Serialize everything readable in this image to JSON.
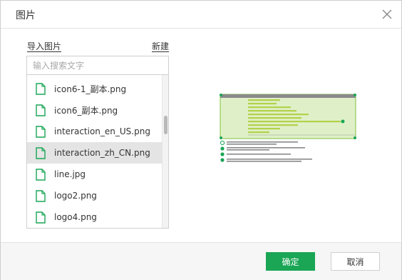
{
  "dialog": {
    "title": "图片",
    "close_icon": "close-icon"
  },
  "panel": {
    "import_label": "导入图片",
    "new_label": "新建",
    "search_placeholder": "输入搜索文字"
  },
  "files": [
    {
      "name": "icon6-1_副本.png",
      "selected": false
    },
    {
      "name": "icon6_副本.png",
      "selected": false
    },
    {
      "name": "interaction_en_US.png",
      "selected": false
    },
    {
      "name": "interaction_zh_CN.png",
      "selected": true
    },
    {
      "name": "line.jpg",
      "selected": false
    },
    {
      "name": "logo2.png",
      "selected": false
    },
    {
      "name": "logo4.png",
      "selected": false
    }
  ],
  "colors": {
    "file_icon": "#1aa655",
    "primary": "#1aa655",
    "selected_row": "#e4e4e4"
  },
  "footer": {
    "ok_label": "确定",
    "cancel_label": "取消"
  }
}
